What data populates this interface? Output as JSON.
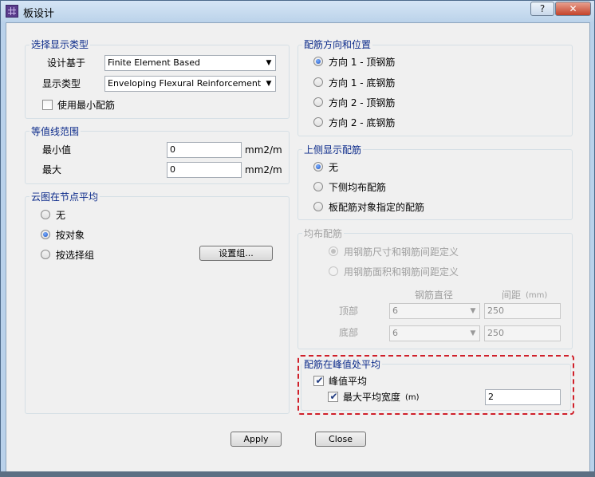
{
  "window": {
    "title": "板设计",
    "help_glyph": "?",
    "close_glyph": "✕"
  },
  "display_type_group": {
    "title": "选择显示类型",
    "design_basis_label": "设计基于",
    "design_basis_value": "Finite Element Based",
    "display_type_label": "显示类型",
    "display_type_value": "Enveloping Flexural Reinforcement",
    "use_min_rebar_label": "使用最小配筋",
    "use_min_rebar_checked": false
  },
  "contour_range_group": {
    "title": "等值线范围",
    "min_label": "最小值",
    "min_value": "0",
    "min_unit": "mm2/m",
    "max_label": "最大",
    "max_value": "0",
    "max_unit": "mm2/m"
  },
  "node_average_group": {
    "title": "云图在节点平均",
    "options": [
      {
        "label": "无",
        "selected": false
      },
      {
        "label": "按对象",
        "selected": true
      },
      {
        "label": "按选择组",
        "selected": false
      }
    ],
    "set_group_button": "设置组..."
  },
  "rebar_direction_group": {
    "title": "配筋方向和位置",
    "options": [
      {
        "label": "方向 1 - 顶钢筋",
        "selected": true
      },
      {
        "label": "方向 1 - 底钢筋",
        "selected": false
      },
      {
        "label": "方向 2 - 顶钢筋",
        "selected": false
      },
      {
        "label": "方向 2 - 底钢筋",
        "selected": false
      }
    ]
  },
  "top_display_group": {
    "title": "上侧显示配筋",
    "options": [
      {
        "label": "无",
        "selected": true
      },
      {
        "label": "下侧均布配筋",
        "selected": false
      },
      {
        "label": "板配筋对象指定的配筋",
        "selected": false
      }
    ]
  },
  "uniform_rebar_group": {
    "title": "均布配筋",
    "options": [
      {
        "label": "用钢筋尺寸和钢筋间距定义",
        "selected": true
      },
      {
        "label": "用钢筋面积和钢筋间距定义",
        "selected": false
      }
    ],
    "bar_size_header": "钢筋直径",
    "spacing_header": "间距",
    "spacing_unit": "(mm)",
    "top_label": "顶部",
    "top_bar_size": "6",
    "top_spacing": "250",
    "bottom_label": "底部",
    "bottom_bar_size": "6",
    "bottom_spacing": "250"
  },
  "peak_average_group": {
    "title": "配筋在峰值处平均",
    "peak_average_label": "峰值平均",
    "peak_average_checked": true,
    "max_width_label": "最大平均宽度",
    "max_width_unit": "(m)",
    "max_width_checked": true,
    "max_width_value": "2"
  },
  "footer": {
    "apply_label": "Apply",
    "close_label": "Close"
  },
  "glyphs": {
    "check": "✔",
    "dropdown": "▼"
  },
  "colors": {
    "group_title": "#0b2a8a",
    "highlight_dash": "#d0202a",
    "disabled_text": "#a0a0a0"
  }
}
